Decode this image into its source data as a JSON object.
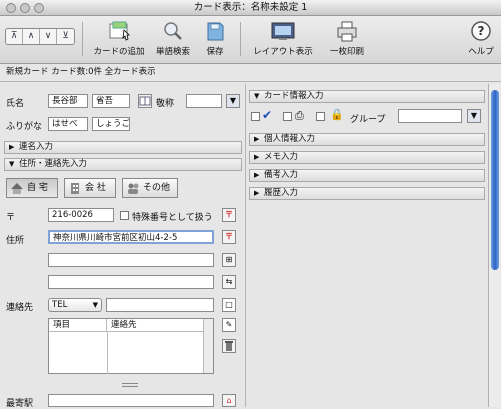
{
  "window": {
    "title": "カード表示：名称未設定 1"
  },
  "toolbar": {
    "nav_buttons": [
      "⊼",
      "∧",
      "∨",
      "⊻"
    ],
    "add_card": "カードの追加",
    "word_search": "単語検索",
    "save": "保存",
    "layout_view": "レイアウト表示",
    "list_print": "一枚印刷",
    "help": "ヘルプ"
  },
  "status": {
    "text": "新規カード カード数:0件 全カード表示"
  },
  "left": {
    "name_label": "氏名",
    "family_name": "長谷部",
    "given_name": "省吾",
    "honorific_label": "敬称",
    "honorific_value": "",
    "furigana_label": "ふりがな",
    "furigana_family": "はせべ",
    "furigana_given": "しょうご",
    "joint_name_section": "連名入力",
    "address_section": "住所・連絡先入力",
    "tabs": [
      "自 宅",
      "会 社",
      "その他"
    ],
    "postal_label": "〒",
    "postal_code": "216-0026",
    "special_number_label": "特殊番号として扱う",
    "address_label": "住所",
    "address_line1": "神奈川県川崎市宮前区初山4-2-5",
    "address_line2": "",
    "address_line3": "",
    "contact_label": "連絡先",
    "contact_type": "TEL",
    "contact_value": "",
    "table_headers": [
      "項目",
      "連絡先"
    ],
    "nearest_station_label": "最寄駅"
  },
  "right": {
    "card_info_section": "カード情報入力",
    "group_label": "グループ",
    "group_value": "",
    "personal_section": "個人情報入力",
    "memo_section": "メモ入力",
    "notes_section": "備考入力",
    "history_section": "履歴入力"
  }
}
